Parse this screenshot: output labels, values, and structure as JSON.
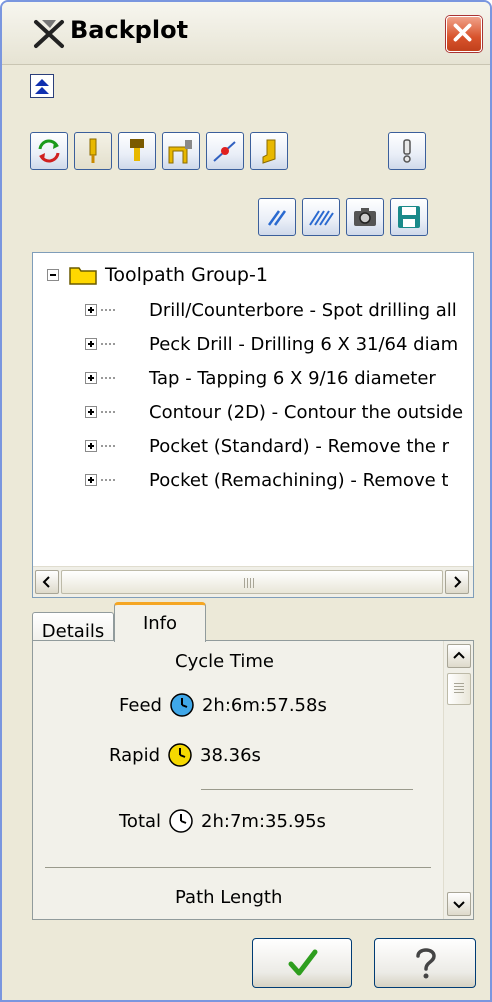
{
  "window": {
    "title": "Backplot"
  },
  "toolbar": {
    "row1_icons": [
      "refresh-icon",
      "tool-icon",
      "holder-icon",
      "stock-icon",
      "vector-icon",
      "shank-icon"
    ],
    "info_icon": "info-icon",
    "row2_icons": [
      "hatch-icon",
      "double-hatch-icon",
      "camera-icon",
      "save-icon"
    ]
  },
  "tree": {
    "root_label": "Toolpath Group-1",
    "items": [
      {
        "label": "Drill/Counterbore - Spot drilling all"
      },
      {
        "label": "Peck Drill - Drilling 6 X 31/64 diam"
      },
      {
        "label": "Tap - Tapping 6 X 9/16 diameter"
      },
      {
        "label": "Contour (2D) - Contour the outside"
      },
      {
        "label": "Pocket (Standard) - Remove the r"
      },
      {
        "label": "Pocket (Remachining) - Remove t"
      }
    ]
  },
  "tabs": {
    "details": "Details",
    "info": "Info",
    "active": "Info"
  },
  "info": {
    "cycle_time_header": "Cycle Time",
    "feed_label": "Feed",
    "feed_value": "2h:6m:57.58s",
    "rapid_label": "Rapid",
    "rapid_value": "38.36s",
    "total_label": "Total",
    "total_value": "2h:7m:35.95s",
    "path_length_header": "Path Length"
  },
  "buttons": {
    "ok_icon": "checkmark-icon",
    "help_icon": "question-icon"
  },
  "colors": {
    "title_bar_close": "#d8532c",
    "tab_highlight": "#f5a623",
    "ok_check": "#2e9e1e",
    "feed_clock": "#3fa7e8",
    "rapid_clock": "#f5d800",
    "total_clock": "#ffffff"
  }
}
